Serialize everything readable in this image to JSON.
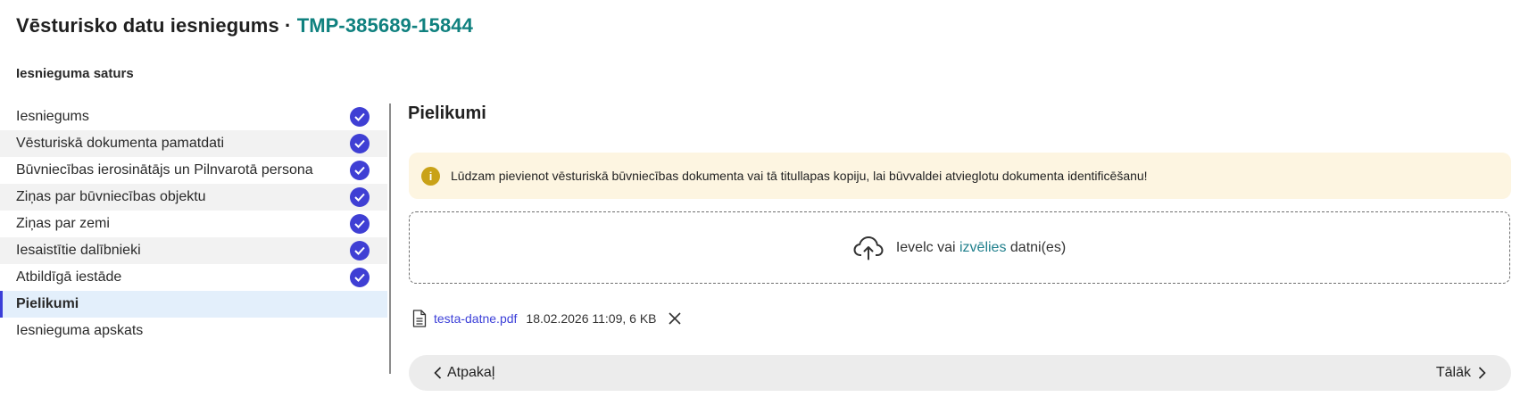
{
  "header": {
    "title": "Vēsturisko datu iesniegums",
    "separator": "·",
    "code": "TMP-385689-15844"
  },
  "sidebar": {
    "heading": "Iesnieguma saturs",
    "items": [
      {
        "label": "Iesniegums",
        "completed": true
      },
      {
        "label": "Vēsturiskā dokumenta pamatdati",
        "completed": true
      },
      {
        "label": "Būvniecības ierosinātājs un Pilnvarotā persona",
        "completed": true
      },
      {
        "label": "Ziņas par būvniecības objektu",
        "completed": true
      },
      {
        "label": "Ziņas par zemi",
        "completed": true
      },
      {
        "label": "Iesaistītie dalībnieki",
        "completed": true
      },
      {
        "label": "Atbildīgā iestāde",
        "completed": true
      },
      {
        "label": "Pielikumi",
        "completed": false,
        "active": true
      },
      {
        "label": "Iesnieguma apskats",
        "completed": false
      }
    ]
  },
  "main": {
    "title": "Pielikumi",
    "notice": {
      "icon": "info-icon",
      "text": "Lūdzam pievienot vēsturiskā būvniecības dokumenta vai tā titullapas kopiju, lai būvvaldei atvieglotu dokumenta identificēšanu!"
    },
    "dropzone": {
      "icon": "cloud-upload-icon",
      "prefix": "Ievelc vai",
      "link": "izvēlies",
      "suffix": "datni(es)"
    },
    "files": [
      {
        "name": "testa-datne.pdf",
        "meta": "18.02.2026 11:09, 6 KB"
      }
    ]
  },
  "footer": {
    "back_label": "Atpakaļ",
    "next_label": "Tālāk"
  },
  "colors": {
    "accent": "#3b3fd8",
    "code": "#10817f",
    "notice_bg": "#fdf5e1",
    "active_bg": "#e3effb"
  }
}
